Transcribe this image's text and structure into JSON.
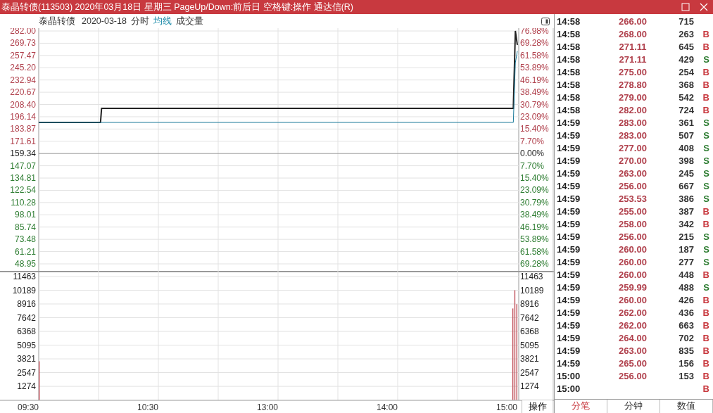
{
  "window": {
    "title": "泰晶转债(113503) 2020年03月18日 星期三 PageUp/Down:前后日 空格键:操作 通达信(R)"
  },
  "chart_header": {
    "name": "泰晶转债",
    "date": "2020-03-18",
    "mode": "分时",
    "indicators": [
      {
        "label": "均线",
        "highlighted": true
      },
      {
        "label": "成交量",
        "highlighted": false
      }
    ]
  },
  "price_panel": {
    "left_axis": [
      {
        "text": "282.00",
        "kind": "up"
      },
      {
        "text": "269.73",
        "kind": "up"
      },
      {
        "text": "257.47",
        "kind": "up"
      },
      {
        "text": "245.20",
        "kind": "up"
      },
      {
        "text": "232.94",
        "kind": "up"
      },
      {
        "text": "220.67",
        "kind": "up"
      },
      {
        "text": "208.40",
        "kind": "up"
      },
      {
        "text": "196.14",
        "kind": "up"
      },
      {
        "text": "183.87",
        "kind": "up"
      },
      {
        "text": "171.61",
        "kind": "up"
      },
      {
        "text": "159.34",
        "kind": "flat"
      },
      {
        "text": "147.07",
        "kind": "down"
      },
      {
        "text": "134.81",
        "kind": "down"
      },
      {
        "text": "122.54",
        "kind": "down"
      },
      {
        "text": "110.28",
        "kind": "down"
      },
      {
        "text": "98.01",
        "kind": "down"
      },
      {
        "text": "85.74",
        "kind": "down"
      },
      {
        "text": "73.48",
        "kind": "down"
      },
      {
        "text": "61.21",
        "kind": "down"
      },
      {
        "text": "48.95",
        "kind": "down"
      }
    ],
    "right_axis": [
      {
        "text": "76.98%",
        "kind": "up"
      },
      {
        "text": "69.28%",
        "kind": "up"
      },
      {
        "text": "61.58%",
        "kind": "up"
      },
      {
        "text": "53.89%",
        "kind": "up"
      },
      {
        "text": "46.19%",
        "kind": "up"
      },
      {
        "text": "38.49%",
        "kind": "up"
      },
      {
        "text": "30.79%",
        "kind": "up"
      },
      {
        "text": "23.09%",
        "kind": "up"
      },
      {
        "text": "15.40%",
        "kind": "up"
      },
      {
        "text": "7.70%",
        "kind": "up"
      },
      {
        "text": "0.00%",
        "kind": "flat"
      },
      {
        "text": "7.70%",
        "kind": "down"
      },
      {
        "text": "15.40%",
        "kind": "down"
      },
      {
        "text": "23.09%",
        "kind": "down"
      },
      {
        "text": "30.79%",
        "kind": "down"
      },
      {
        "text": "38.49%",
        "kind": "down"
      },
      {
        "text": "46.19%",
        "kind": "down"
      },
      {
        "text": "53.89%",
        "kind": "down"
      },
      {
        "text": "61.58%",
        "kind": "down"
      },
      {
        "text": "69.28%",
        "kind": "down"
      }
    ],
    "kind": "picture"
  },
  "volume_panel": {
    "left_axis": [
      "11463",
      "10189",
      "8916",
      "7642",
      "6368",
      "5095",
      "3821",
      "2547",
      "1274"
    ],
    "right_axis": [
      "11463",
      "10189",
      "8916",
      "7642",
      "6368",
      "5095",
      "3821",
      "2547",
      "1274"
    ],
    "kind": "picture",
    "time_axis": [
      "09:30",
      "10:30",
      "13:00",
      "14:00",
      "15:00"
    ]
  },
  "action_button": "操作",
  "trades": [
    {
      "time": "14:58",
      "price": "266.00",
      "volume": "715"
    },
    {
      "time": "14:58",
      "price": "268.00",
      "volume": "263",
      "side": "B"
    },
    {
      "time": "14:58",
      "price": "271.11",
      "volume": "645",
      "side": "B"
    },
    {
      "time": "14:58",
      "price": "271.11",
      "volume": "429",
      "side": "S"
    },
    {
      "time": "14:58",
      "price": "275.00",
      "volume": "254",
      "side": "B"
    },
    {
      "time": "14:58",
      "price": "278.80",
      "volume": "368",
      "side": "B"
    },
    {
      "time": "14:58",
      "price": "279.00",
      "volume": "542",
      "side": "B"
    },
    {
      "time": "14:58",
      "price": "282.00",
      "volume": "724",
      "side": "B"
    },
    {
      "time": "14:59",
      "price": "283.00",
      "volume": "361",
      "side": "S"
    },
    {
      "time": "14:59",
      "price": "283.00",
      "volume": "507",
      "side": "S"
    },
    {
      "time": "14:59",
      "price": "277.00",
      "volume": "408",
      "side": "S"
    },
    {
      "time": "14:59",
      "price": "270.00",
      "volume": "398",
      "side": "S"
    },
    {
      "time": "14:59",
      "price": "263.00",
      "volume": "245",
      "side": "S"
    },
    {
      "time": "14:59",
      "price": "256.00",
      "volume": "667",
      "side": "S"
    },
    {
      "time": "14:59",
      "price": "253.53",
      "volume": "386",
      "side": "S"
    },
    {
      "time": "14:59",
      "price": "255.00",
      "volume": "387",
      "side": "B"
    },
    {
      "time": "14:59",
      "price": "258.00",
      "volume": "342",
      "side": "B"
    },
    {
      "time": "14:59",
      "price": "256.00",
      "volume": "215",
      "side": "S"
    },
    {
      "time": "14:59",
      "price": "260.00",
      "volume": "187",
      "side": "S"
    },
    {
      "time": "14:59",
      "price": "260.00",
      "volume": "277",
      "side": "S"
    },
    {
      "time": "14:59",
      "price": "260.00",
      "volume": "448",
      "side": "B"
    },
    {
      "time": "14:59",
      "price": "259.99",
      "volume": "488",
      "side": "S"
    },
    {
      "time": "14:59",
      "price": "260.00",
      "volume": "426",
      "side": "B"
    },
    {
      "time": "14:59",
      "price": "262.00",
      "volume": "436",
      "side": "B"
    },
    {
      "time": "14:59",
      "price": "262.00",
      "volume": "663",
      "side": "B"
    },
    {
      "time": "14:59",
      "price": "264.00",
      "volume": "702",
      "side": "B"
    },
    {
      "time": "14:59",
      "price": "263.00",
      "volume": "835",
      "side": "B"
    },
    {
      "time": "14:59",
      "price": "265.00",
      "volume": "156",
      "side": "B"
    },
    {
      "time": "15:00",
      "price": "256.00",
      "volume": "153",
      "side": "B"
    },
    {
      "time": "15:00",
      "side": "B"
    }
  ],
  "bottom_tabs": [
    {
      "label": "分笔",
      "selected": true
    },
    {
      "label": "分钟",
      "selected": false
    },
    {
      "label": "数值",
      "selected": false
    }
  ]
}
